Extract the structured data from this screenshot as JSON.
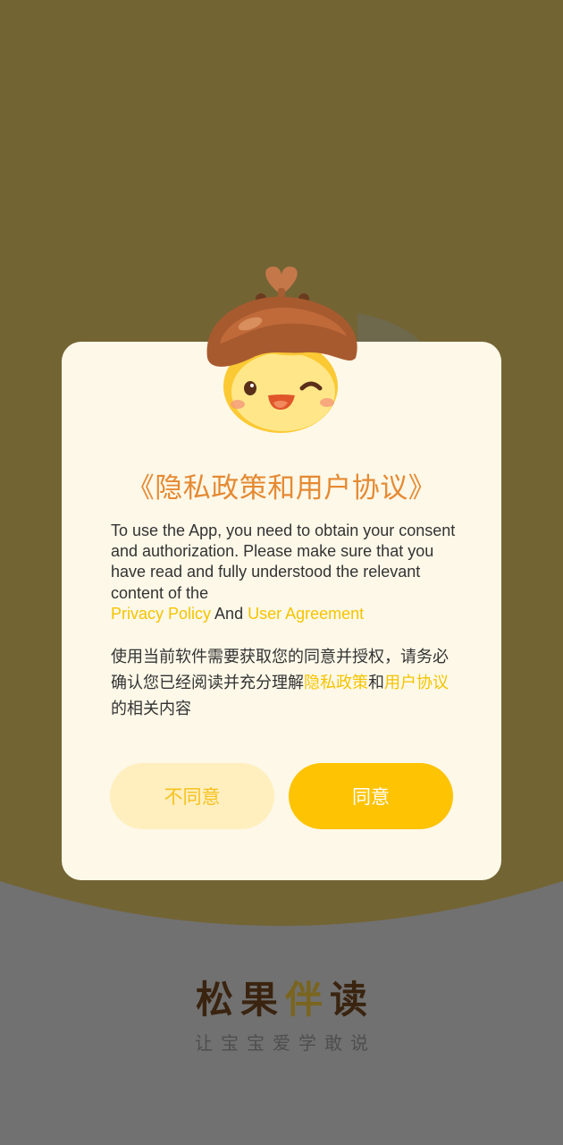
{
  "dialog": {
    "title": "《隐私政策和用户协议》",
    "en_body": "To use the App, you need to obtain your consent and authorization. Please make sure that you have read and fully understood the relevant content of the",
    "en_link_privacy": "Privacy Policy",
    "en_and": "And",
    "en_link_agreement": "User Agreement",
    "zh_body": "使用当前软件需要获取您的同意并授权，请务必确认您已经阅读并充分理解",
    "zh_link_privacy": "隐私政策",
    "zh_and": "和",
    "zh_link_agreement": "用户协议",
    "zh_tail": "的相关内容",
    "disagree_label": "不同意",
    "agree_label": "同意"
  },
  "brand": {
    "logo_char_1": "松",
    "logo_char_2": "果",
    "logo_char_3": "伴",
    "logo_char_4": "读",
    "slogan": "让宝宝爱学敢说"
  },
  "colors": {
    "overlay_top": "#736434",
    "page_bottom": "#717171",
    "dialog_bg": "#fdf8e8",
    "title": "#e58a33",
    "link": "#f5c400",
    "agree_button": "#fec303",
    "disagree_button": "#ffefbe"
  },
  "icons": {
    "mascot": "acorn-mascot-icon",
    "logo": "brand-logo"
  }
}
